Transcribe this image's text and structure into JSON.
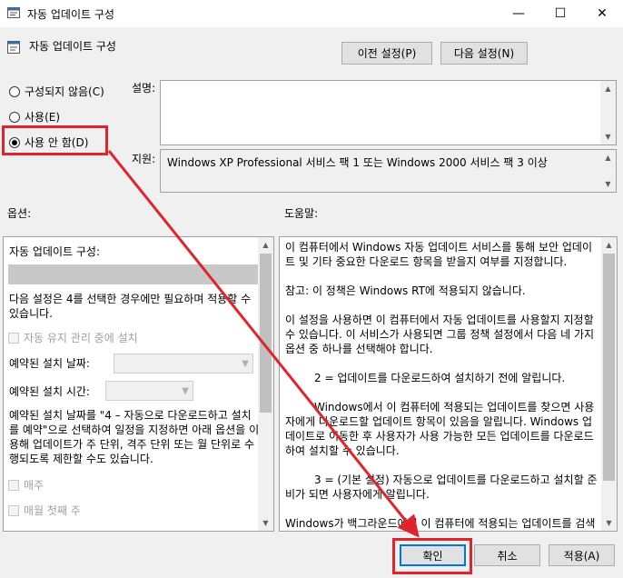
{
  "window": {
    "title": "자동 업데이트 구성",
    "icon": "policy-settings-icon",
    "controls": {
      "minimize": "—",
      "maximize": "☐",
      "close": "✕"
    }
  },
  "header": {
    "title": "자동 업데이트 구성",
    "prev_label": "이전 설정(P)",
    "next_label": "다음 설정(N)"
  },
  "radios": [
    {
      "label": "구성되지 않음(C)",
      "checked": false
    },
    {
      "label": "사용(E)",
      "checked": false
    },
    {
      "label": "사용 안 함(D)",
      "checked": true
    }
  ],
  "comment": {
    "label": "설명:",
    "value": ""
  },
  "supported": {
    "label": "지원:",
    "value": "Windows XP Professional 서비스 팩 1 또는 Windows 2000 서비스 팩 3 이상"
  },
  "options": {
    "label": "옵션:",
    "configure_label": "자동 업데이트 구성:",
    "note": "다음 설정은 4를 선택한 경우에만 필요하며 적용할 수 있습니다.",
    "maintenance_label": "자동 유지 관리 중에 설치",
    "day_label": "예약된 설치 날짜:",
    "time_label": "예약된 설치 시간:",
    "schedule_note": "예약된 설치 날짜를 \"4 – 자동으로 다운로드하고 설치를 예약\"으로 선택하여 일정을 지정하면 아래 옵션을 이용해 업데이트가 주 단위, 격주 단위 또는 월 단위로 수행되도록 제한할 수도 있습니다.",
    "weekly_label": "매주",
    "first_week_label": "매월 첫째 주"
  },
  "help": {
    "label": "도움말:",
    "paragraphs": [
      "이 컴퓨터에서 Windows 자동 업데이트 서비스를 통해 보안 업데이트 및 기타 중요한 다운로드 항목을 받을지 여부를 지정합니다.",
      "참고: 이 정책은 Windows RT에 적용되지 않습니다.",
      "이 설정을 사용하면 이 컴퓨터에서 자동 업데이트를 사용할지 지정할 수 있습니다. 이 서비스가 사용되면 그룹 정책 설정에서 다음 네 가지 옵션 중 하나를 선택해야 합니다.",
      "2 = 업데이트를 다운로드하여 설치하기 전에 알립니다.",
      "Windows에서 이 컴퓨터에 적용되는 업데이트를 찾으면 사용자에게 다운로드할 업데이트 항목이 있음을 알립니다. Windows 업데이트로 이동한 후 사용자가 사용 가능한 모든 업데이트를 다운로드하여 설치할 수 있습니다.",
      "3 = (기본 설정) 자동으로 업데이트를 다운로드하고 설치할 준비가 되면 사용자에게 알립니다.",
      "Windows가 백그라운드에서 이 컴퓨터에 적용되는 업데이트를 검색하고 다운로드합니다"
    ]
  },
  "footer": {
    "ok_label": "확인",
    "cancel_label": "취소",
    "apply_label": "적용(A)"
  },
  "annotation_color": "#e0242c"
}
